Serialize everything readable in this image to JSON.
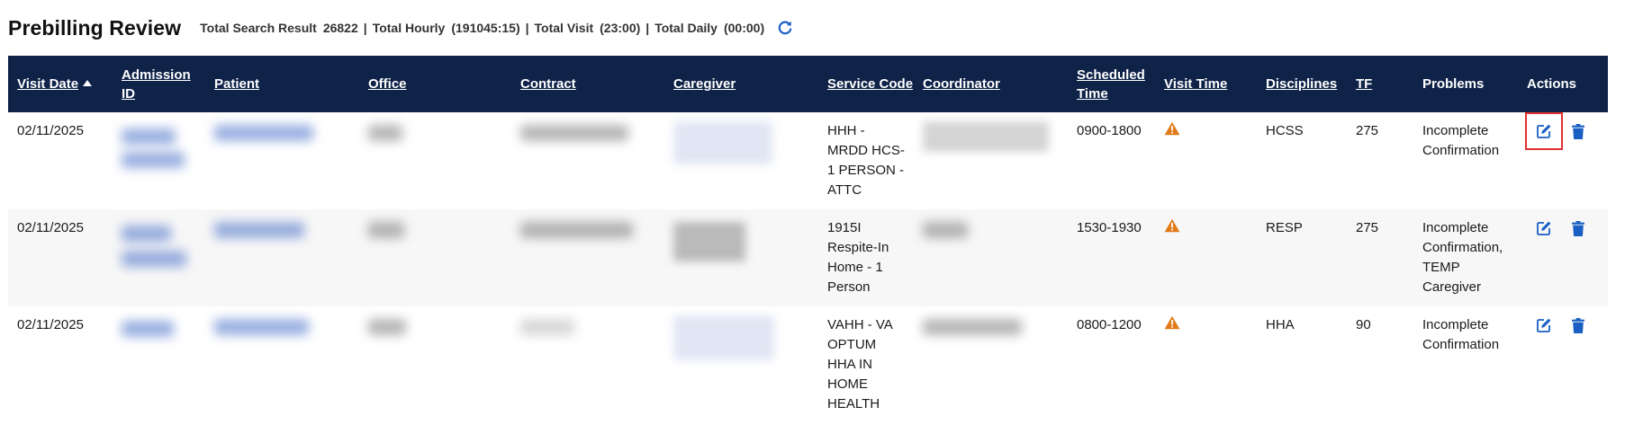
{
  "header": {
    "title": "Prebilling Review",
    "stats": [
      {
        "label": "Total Search Result",
        "value": "26822"
      },
      {
        "label": "Total Hourly",
        "value": "(191045:15)"
      },
      {
        "label": "Total Visit",
        "value": "(23:00)"
      },
      {
        "label": "Total Daily",
        "value": "(00:00)"
      }
    ],
    "separator": "|",
    "refresh_icon": "refresh-icon"
  },
  "colors": {
    "header_bg": "#0f2248",
    "warning": "#e07b1a",
    "action_blue": "#1a5fc4",
    "selected_outline": "#e03030"
  },
  "columns": {
    "visit_date": "Visit Date",
    "admission_id": "Admission ID",
    "patient": "Patient",
    "office": "Office",
    "contract": "Contract",
    "caregiver": "Caregiver",
    "service_code": "Service Code",
    "coordinator": "Coordinator",
    "scheduled_time": "Scheduled Time",
    "visit_time": "Visit Time",
    "disciplines": "Disciplines",
    "tf": "TF",
    "problems": "Problems",
    "actions": "Actions"
  },
  "rows": [
    {
      "visit_date": "02/11/2025",
      "service_code": "HHH - MRDD HCS-1 PERSON - ATTC",
      "scheduled_time": "0900-1800",
      "visit_time_icon": "warning-icon",
      "disciplines": "HCSS",
      "tf": "275",
      "problems": "Incomplete Confirmation",
      "edit_icon": "edit-icon",
      "delete_icon": "trash-icon"
    },
    {
      "visit_date": "02/11/2025",
      "service_code": "1915I Respite-In Home - 1 Person",
      "scheduled_time": "1530-1930",
      "visit_time_icon": "warning-icon",
      "disciplines": "RESP",
      "tf": "275",
      "problems": "Incomplete Confirmation, TEMP Caregiver",
      "edit_icon": "edit-icon",
      "delete_icon": "trash-icon"
    },
    {
      "visit_date": "02/11/2025",
      "service_code": "VAHH - VA OPTUM HHA IN HOME HEALTH",
      "scheduled_time": "0800-1200",
      "visit_time_icon": "warning-icon",
      "disciplines": "HHA",
      "tf": "90",
      "problems": "Incomplete Confirmation",
      "edit_icon": "edit-icon",
      "delete_icon": "trash-icon"
    }
  ]
}
